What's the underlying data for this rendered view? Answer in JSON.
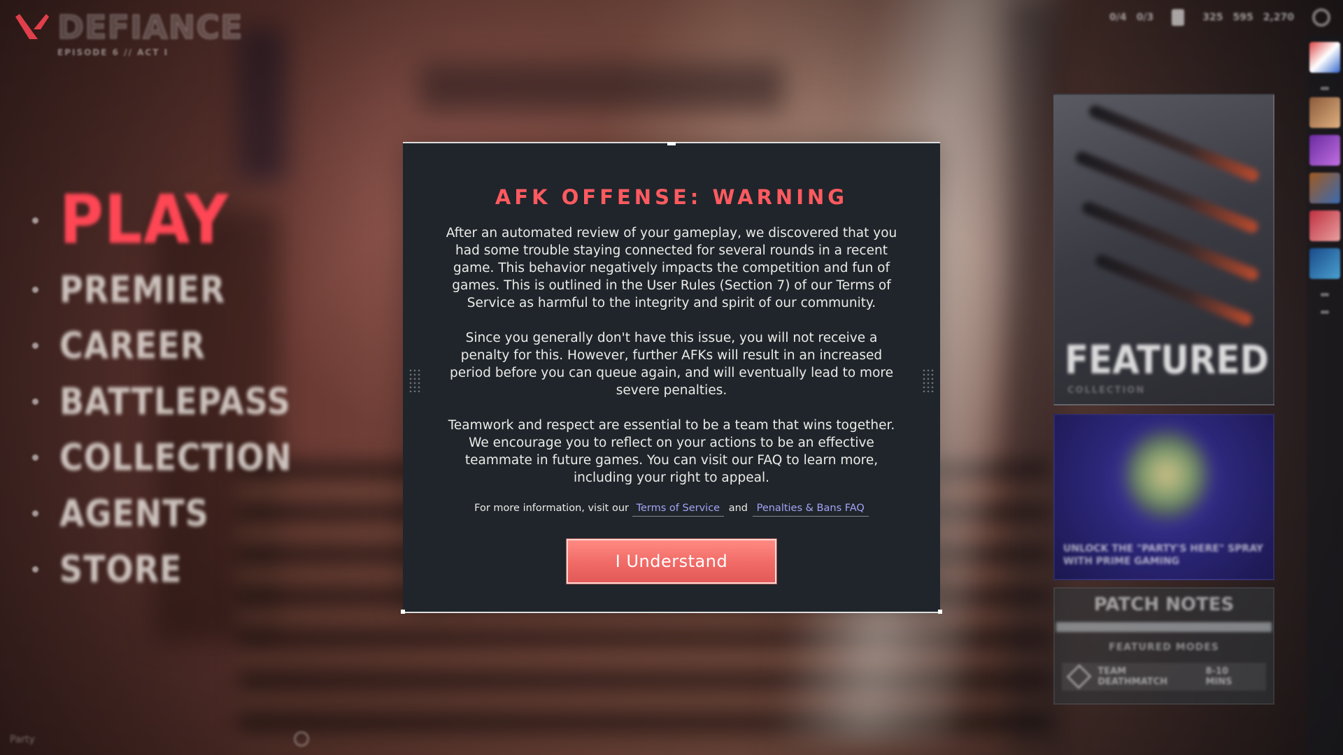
{
  "brand": {
    "title": "DEFIANCE",
    "subtitle": "EPISODE 6 // ACT I"
  },
  "nav": {
    "items": [
      {
        "label": "PLAY"
      },
      {
        "label": "PREMIER"
      },
      {
        "label": "CAREER"
      },
      {
        "label": "BATTLEPASS"
      },
      {
        "label": "COLLECTION"
      },
      {
        "label": "AGENTS"
      },
      {
        "label": "STORE"
      }
    ]
  },
  "topbar": {
    "stat1": "0/4",
    "stat2": "0/3",
    "currency1": "325",
    "currency2": "595",
    "currency3": "2,270"
  },
  "panels": {
    "featured_title": "FEATURED",
    "featured_sub": "COLLECTION",
    "promo_text": "UNLOCK THE \"PARTY'S HERE\" SPRAY WITH PRIME GAMING",
    "patch_title": "PATCH NOTES",
    "featured_modes": "FEATURED MODES",
    "mode_name": "TEAM DEATHMATCH",
    "mode_time": "8-10 MINS"
  },
  "party": {
    "label": "Party"
  },
  "modal": {
    "title": "AFK OFFENSE: WARNING",
    "paragraphs": [
      "After an automated review of your gameplay, we discovered that you had some trouble staying connected for several rounds in a recent game. This behavior negatively impacts the competition and fun of games. This is outlined in the User Rules (Section 7) of our Terms of Service as harmful to the integrity and spirit of our community.",
      "Since you generally don't have this issue, you will not receive a penalty for this. However, further AFKs will result in an increased period before you can queue again, and will eventually lead to more severe penalties.",
      "Teamwork and respect are essential to be a team that wins together. We encourage you to reflect on your actions to be an effective teammate in future games. You can visit our FAQ to learn more, including your right to appeal."
    ],
    "footer_prefix": "For more information, visit our",
    "link_tos": "Terms of Service",
    "footer_and": "and",
    "link_faq": "Penalties & Bans FAQ",
    "button_label": "I Understand"
  },
  "colors": {
    "accent_red": "#ff4655",
    "modal_title": "#ff5a5f",
    "link": "#a6a3f5",
    "modal_bg": "#1f252b",
    "button": "#f06a66"
  }
}
